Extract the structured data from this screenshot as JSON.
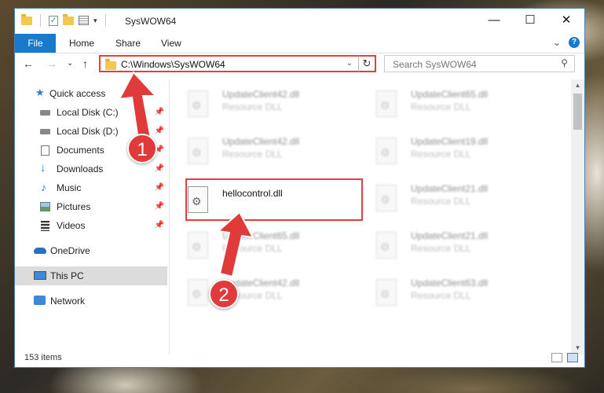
{
  "window": {
    "title": "SysWOW64",
    "controls": {
      "minimize": "—",
      "maximize": "☐",
      "close": "✕"
    }
  },
  "ribbon": {
    "file_tab": "File",
    "tabs": [
      "Home",
      "Share",
      "View"
    ],
    "expand": "⌄",
    "help": "?"
  },
  "nav": {
    "back": "←",
    "forward": "→",
    "recent": "⌄",
    "up": "↑",
    "address_path": "C:\\Windows\\SysWOW64",
    "address_dropdown": "⌄",
    "refresh": "↻",
    "search_placeholder": "Search SysWOW64",
    "search_icon": "⚲"
  },
  "sidebar": {
    "items": [
      {
        "label": "Quick access",
        "icon": "star-icon",
        "pinned": false
      },
      {
        "label": "Local Disk (C:)",
        "icon": "drive-icon",
        "pinned": true
      },
      {
        "label": "Local Disk (D:)",
        "icon": "drive-icon",
        "pinned": true
      },
      {
        "label": "Documents",
        "icon": "documents-icon",
        "pinned": true
      },
      {
        "label": "Downloads",
        "icon": "download-icon",
        "pinned": true
      },
      {
        "label": "Music",
        "icon": "music-icon",
        "pinned": true
      },
      {
        "label": "Pictures",
        "icon": "pictures-icon",
        "pinned": true
      },
      {
        "label": "Videos",
        "icon": "videos-icon",
        "pinned": true
      },
      {
        "label": "OneDrive",
        "icon": "cloud-icon",
        "pinned": false
      },
      {
        "label": "This PC",
        "icon": "computer-icon",
        "pinned": false,
        "selected": true
      },
      {
        "label": "Network",
        "icon": "network-icon",
        "pinned": false
      }
    ],
    "pin_glyph": "📌"
  },
  "files": [
    {
      "name": "UpdateClient42.dll",
      "type": "Resource DLL",
      "blurred": true
    },
    {
      "name": "UpdateClient65.dll",
      "type": "Resource DLL",
      "blurred": true
    },
    {
      "name": "UpdateClient42.dll",
      "type": "Resource DLL",
      "blurred": true
    },
    {
      "name": "UpdateClient19.dll",
      "type": "Resource DLL",
      "blurred": true
    },
    {
      "name": "hellocontrol.dll",
      "type": "",
      "blurred": false,
      "highlighted": true
    },
    {
      "name": "UpdateClient21.dll",
      "type": "Resource DLL",
      "blurred": true
    },
    {
      "name": "UpdateClient65.dll",
      "type": "Resource DLL",
      "blurred": true
    },
    {
      "name": "UpdateClient21.dll",
      "type": "Resource DLL",
      "blurred": true
    },
    {
      "name": "UpdateClient42.dll",
      "type": "Resource DLL",
      "blurred": true
    },
    {
      "name": "UpdateClient63.dll",
      "type": "Resource DLL",
      "blurred": true
    }
  ],
  "status": {
    "item_count": "153 items"
  },
  "annotations": {
    "step1": "1",
    "step2": "2",
    "color": "#e03a3a"
  }
}
